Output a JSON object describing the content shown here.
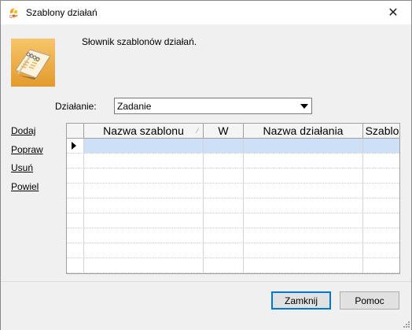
{
  "window": {
    "title": "Szablony działań",
    "close_glyph": "✕",
    "icon": "app-logo-icon"
  },
  "header": {
    "description": "Słownik szablonów działań.",
    "icon": "book-icon"
  },
  "filter": {
    "label": "Działanie:",
    "selected": "Zadanie"
  },
  "actions": {
    "add": "Dodaj",
    "edit": "Popraw",
    "delete": "Usuń",
    "duplicate": "Powiel"
  },
  "grid": {
    "columns": [
      "Nazwa szablonu",
      "W",
      "Nazwa działania",
      "Szablo"
    ],
    "sort_indicator": "⁄",
    "selected_row_indicator": "row-pointer-icon",
    "rows": 9
  },
  "buttons": {
    "close": "Zamknij",
    "help": "Pomoc"
  },
  "colors": {
    "selection": "#cde0f7",
    "default_button_border": "#0078d7"
  }
}
